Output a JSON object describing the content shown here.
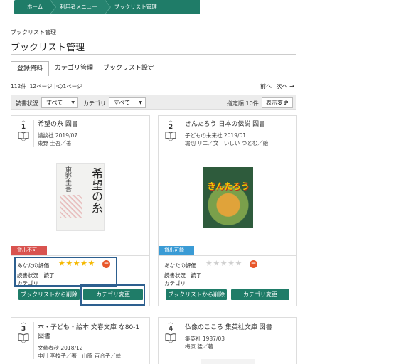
{
  "breadcrumb": [
    "ホーム",
    "利用者メニュー",
    "ブックリスト管理"
  ],
  "header": {
    "small_title": "ブックリスト管理",
    "title": "ブックリスト管理"
  },
  "tabs": [
    {
      "label": "登録資料",
      "active": true
    },
    {
      "label": "カテゴリ管理",
      "active": false
    },
    {
      "label": "ブックリスト設定",
      "active": false
    }
  ],
  "result": {
    "count": "112件",
    "pages": "12ページ中の1ページ"
  },
  "pager": {
    "prev": "前へ",
    "next": "次へ →"
  },
  "filter": {
    "reading_status_label": "読書状況",
    "reading_status_value": "すべて",
    "category_label": "カテゴリ",
    "category_value": "すべて",
    "sort_label": "指定順 10件",
    "change_button": "表示変更"
  },
  "cards": [
    {
      "number": "1",
      "title": "希望の糸 図書",
      "publisher_year": "講談社 2019/07",
      "author": "東野 圭吾／著",
      "status": "貸出不可",
      "status_color": "#d9534f",
      "rating_label": "あなたの評価",
      "rating": 5,
      "stars": "★★★★★",
      "reading_status": "読書状況　読了",
      "category": "カテゴリ",
      "remove_button": "ブックリストから削除",
      "category_button": "カテゴリ変更",
      "cover_text_author": "東野圭吾",
      "cover_text_title": "希望の糸"
    },
    {
      "number": "2",
      "title": "きんたろう 日本の伝説 図書",
      "publisher_year": "子どもの未来社 2019/01",
      "author": "堀切 リエ／文　いしい つとむ／絵",
      "status": "貸出可能",
      "status_color": "#3a9bd5",
      "rating_label": "あなたの評価",
      "rating": 0,
      "stars": "★★★★★",
      "reading_status": "読書状況　読了",
      "category": "カテゴリ",
      "remove_button": "ブックリストから削除",
      "category_button": "カテゴリ変更",
      "cover_text_title": "きんたろう"
    },
    {
      "number": "3",
      "title": "本・子ども・絵本 文春文庫 な80-1 図書",
      "title_line1": "本・子ども・絵本 文春文庫 な80-1",
      "title_line2": "図書",
      "publisher_year": "文藝春秋 2018/12",
      "author": "中川 李枝子／著　山脇 百合子／絵"
    },
    {
      "number": "4",
      "title": "仏像のこころ 集英社文庫 図書",
      "publisher_year": "集英社 1987/03",
      "author": "梅原 猛／著"
    }
  ],
  "colors": {
    "accent": "#1f7c68",
    "star_on": "#f5b800",
    "star_off": "#cfcfcf",
    "remove_rating": "#e8572a",
    "highlight": "#2d5f8f"
  }
}
